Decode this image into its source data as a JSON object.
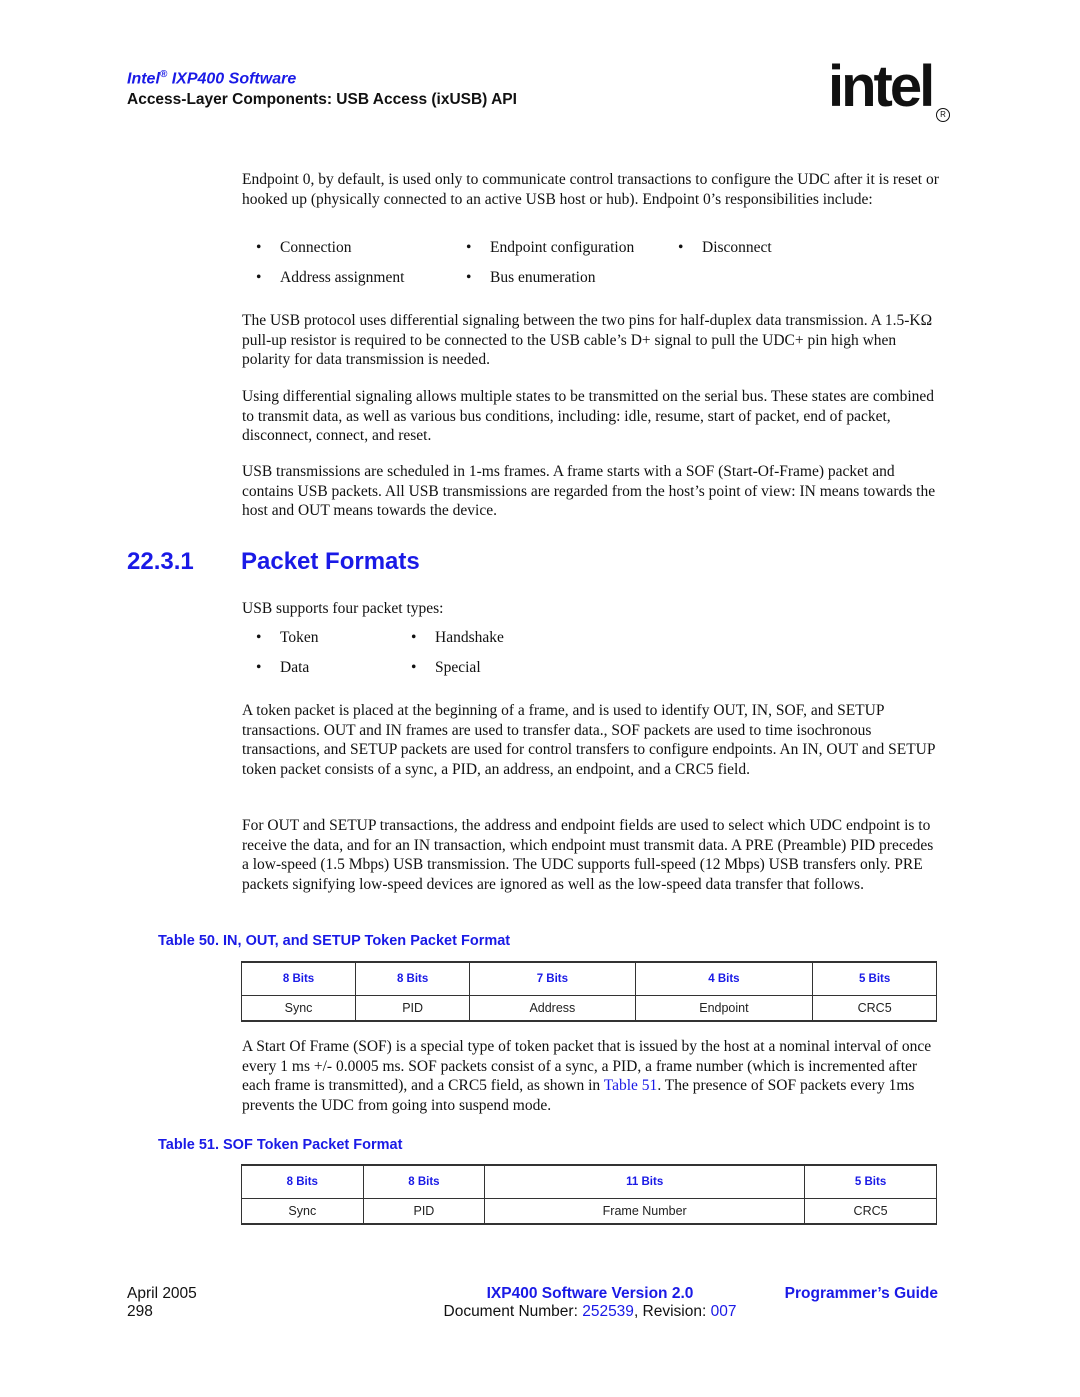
{
  "header": {
    "product_prefix": "Intel",
    "product_reg": "®",
    "product_suffix": " IXP400 Software",
    "section": "Access-Layer Components: USB Access (ixUSB) API",
    "logo_text": "intel",
    "logo_reg": "R"
  },
  "intro": {
    "para1": "Endpoint 0, by default, is used only to communicate control transactions to configure the UDC after it is reset or hooked up (physically connected to an active USB host or hub). Endpoint 0’s responsibilities include:",
    "bullet_symbol": "•",
    "responsibilities": [
      "Connection",
      "Endpoint configuration",
      "Disconnect",
      "Address assignment",
      "Bus enumeration"
    ],
    "para2": "The USB protocol uses differential signaling between the two pins for half-duplex data transmission. A 1.5-KΩ pull-up resistor is required to be connected to the USB cable’s D+ signal to pull the UDC+ pin high when polarity for data transmission is needed.",
    "para3": "Using differential signaling allows multiple states to be transmitted on the serial bus. These states are combined to transmit data, as well as various bus conditions, including: idle, resume, start of packet, end of packet, disconnect, connect, and reset.",
    "para4": "USB transmissions are scheduled in 1-ms frames. A frame starts with a SOF (Start-Of-Frame) packet and contains USB packets. All USB transmissions are regarded from the host’s point of view: IN means towards the host and OUT means towards the device."
  },
  "section": {
    "number": "22.3.1",
    "title": "Packet Formats",
    "lead": "USB supports four packet types:",
    "packet_types": [
      "Token",
      "Handshake",
      "Data",
      "Special"
    ],
    "para1": "A token packet is placed at the beginning of a frame, and is used to identify OUT, IN, SOF, and SETUP transactions. OUT and IN frames are used to transfer data., SOF packets are used to time isochronous transactions, and SETUP packets are used for control transfers to configure endpoints. An IN, OUT and SETUP token packet consists of a sync, a PID, an address, an endpoint, and a CRC5 field.",
    "para2": "For OUT and SETUP transactions, the address and endpoint fields are used to select which UDC endpoint is to receive the data, and for an IN transaction, which endpoint must transmit data. A PRE (Preamble) PID precedes a low-speed (1.5 Mbps) USB transmission. The UDC supports full-speed (12 Mbps) USB transfers only. PRE packets signifying low-speed devices are ignored as well as the low-speed data transfer that follows.",
    "para3_before": "A Start Of Frame (SOF) is a special type of token packet that is issued by the host at a nominal interval of once every 1 ms +/- 0.0005 ms. SOF packets consist of a sync, a PID, a frame number (which is incremented after each frame is transmitted), and a CRC5 field, as shown in ",
    "para3_link": "Table 51",
    "para3_after": ". The presence of SOF packets every 1ms prevents the UDC from going into suspend mode."
  },
  "table50": {
    "caption": "Table 50.  IN, OUT, and SETUP Token Packet Format",
    "bits": [
      "8 Bits",
      "8 Bits",
      "7 Bits",
      "4 Bits",
      "5 Bits"
    ],
    "fields": [
      "Sync",
      "PID",
      "Address",
      "Endpoint",
      "CRC5"
    ]
  },
  "table51": {
    "caption": "Table 51.  SOF Token Packet Format",
    "bits": [
      "8 Bits",
      "8 Bits",
      "11 Bits",
      "5 Bits"
    ],
    "fields": [
      "Sync",
      "PID",
      "Frame Number",
      "CRC5"
    ]
  },
  "footer": {
    "date": "April 2005",
    "page": "298",
    "doc_title": "IXP400 Software Version 2.0",
    "doc_number_label": "Document Number: ",
    "doc_number": "252539",
    "revision_label": ", Revision: ",
    "revision": "007",
    "guide": "Programmer’s Guide"
  },
  "colors": {
    "accent_blue": "#1a1ae6",
    "text": "#111111"
  }
}
